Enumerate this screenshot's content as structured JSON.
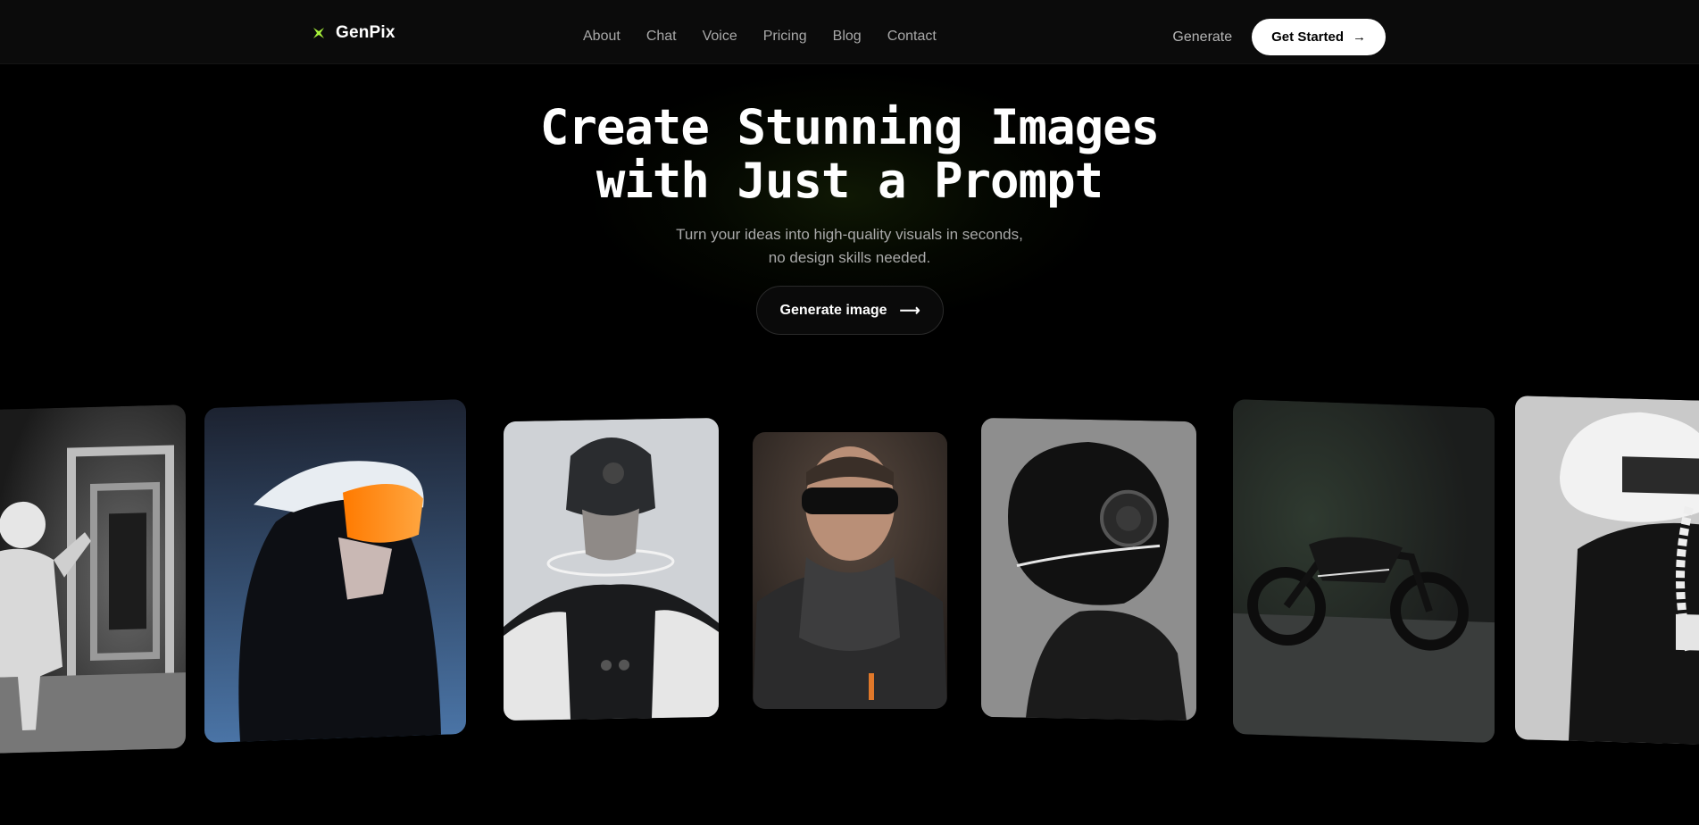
{
  "brand": {
    "name": "GenPix",
    "accent": "#a6f03a"
  },
  "nav": {
    "links": [
      "About",
      "Chat",
      "Voice",
      "Pricing",
      "Blog",
      "Contact"
    ],
    "generate_label": "Generate",
    "get_started_label": "Get Started",
    "arrow": "→"
  },
  "hero": {
    "title_line1": "Create Stunning Images",
    "title_line2": "with Just a Prompt",
    "subtitle_line1": "Turn your ideas into high-quality visuals in seconds,",
    "subtitle_line2": "no design skills needed.",
    "cta_label": "Generate image",
    "cta_arrow": "⟶"
  },
  "gallery": {
    "images": [
      {
        "name": "astronaut-in-tunnel-image",
        "tone": "#8a8a8a"
      },
      {
        "name": "orange-visor-hood-image",
        "tone": "#3a5a85"
      },
      {
        "name": "cyber-helmet-halo-image",
        "tone": "#c8cbd0"
      },
      {
        "name": "goggles-hoodie-portrait-image",
        "tone": "#3a342f"
      },
      {
        "name": "black-helmet-profile-image",
        "tone": "#8c8c8c"
      },
      {
        "name": "concept-motorcycle-image",
        "tone": "#2a2d2b"
      },
      {
        "name": "white-helmet-tech-jacket-image",
        "tone": "#c8c8c8"
      }
    ]
  }
}
